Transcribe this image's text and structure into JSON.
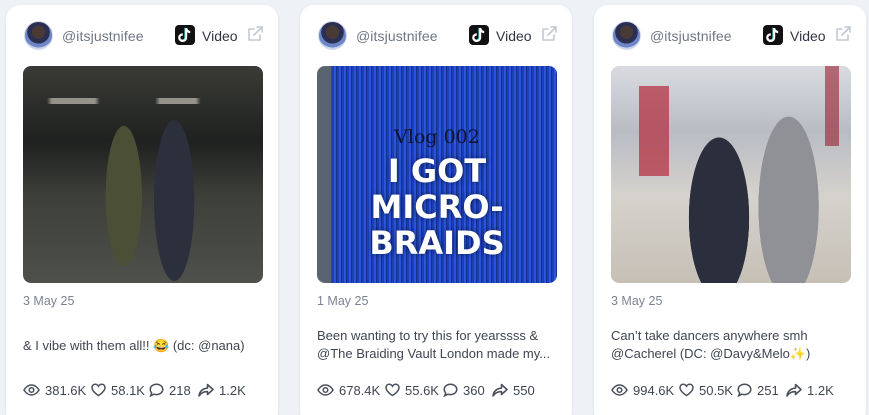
{
  "cards": [
    {
      "handle": "@itsjustnifee",
      "platform_icon": "tiktok-icon",
      "platform_label": "Video",
      "date": "3 May 25",
      "caption_lines": [
        "& I vibe with them all!! 😂 (dc: @nana)"
      ],
      "views": "381.6K",
      "likes": "58.1K",
      "comments": "218",
      "shares": "1.2K"
    },
    {
      "handle": "@itsjustnifee",
      "platform_icon": "tiktok-icon",
      "platform_label": "Video",
      "date": "1 May 25",
      "thumbnail_text": {
        "sub": "Vlog 002",
        "line1": "I GOT",
        "line2": "MICRO-",
        "line3": "BRAIDS"
      },
      "caption_lines": [
        "Been wanting to try this for yearssss &",
        "@The Braiding Vault London made my..."
      ],
      "views": "678.4K",
      "likes": "55.6K",
      "comments": "360",
      "shares": "550"
    },
    {
      "handle": "@itsjustnifee",
      "platform_icon": "tiktok-icon",
      "platform_label": "Video",
      "date": "3 May 25",
      "caption_lines": [
        "Can’t take dancers anywhere smh",
        "@Cacherel (DC: @Davy&Melo✨)"
      ],
      "views": "994.6K",
      "likes": "50.5K",
      "comments": "251",
      "shares": "1.2K"
    }
  ]
}
